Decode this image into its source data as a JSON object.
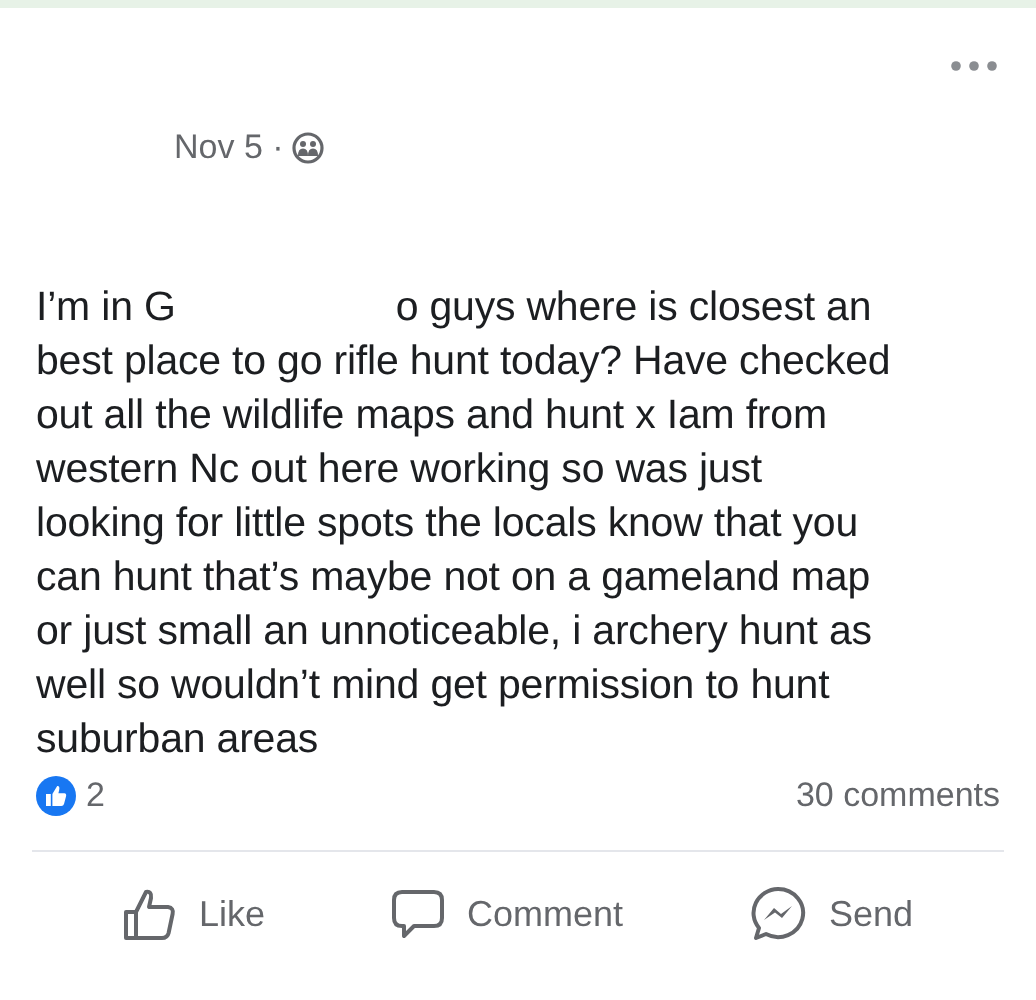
{
  "post": {
    "date": "Nov 5 ·",
    "body_lines": [
      "I’m in G",
      "o guys where is closest an",
      "best place to go rifle hunt today? Have checked",
      "out all the wildlife maps and hunt x Iam from",
      "western Nc out here working so was just",
      "looking for little spots the locals know that you",
      "can hunt that’s maybe not on a gameland map",
      "or just small an unnoticeable, i archery hunt as",
      "well so wouldn’t mind get permission to hunt",
      "suburban areas"
    ],
    "like_count": "2",
    "comment_count": "30 comments"
  },
  "actions": [
    {
      "kind": "like",
      "label": "Like"
    },
    {
      "kind": "comment",
      "label": "Comment"
    },
    {
      "kind": "send",
      "label": "Send"
    }
  ]
}
